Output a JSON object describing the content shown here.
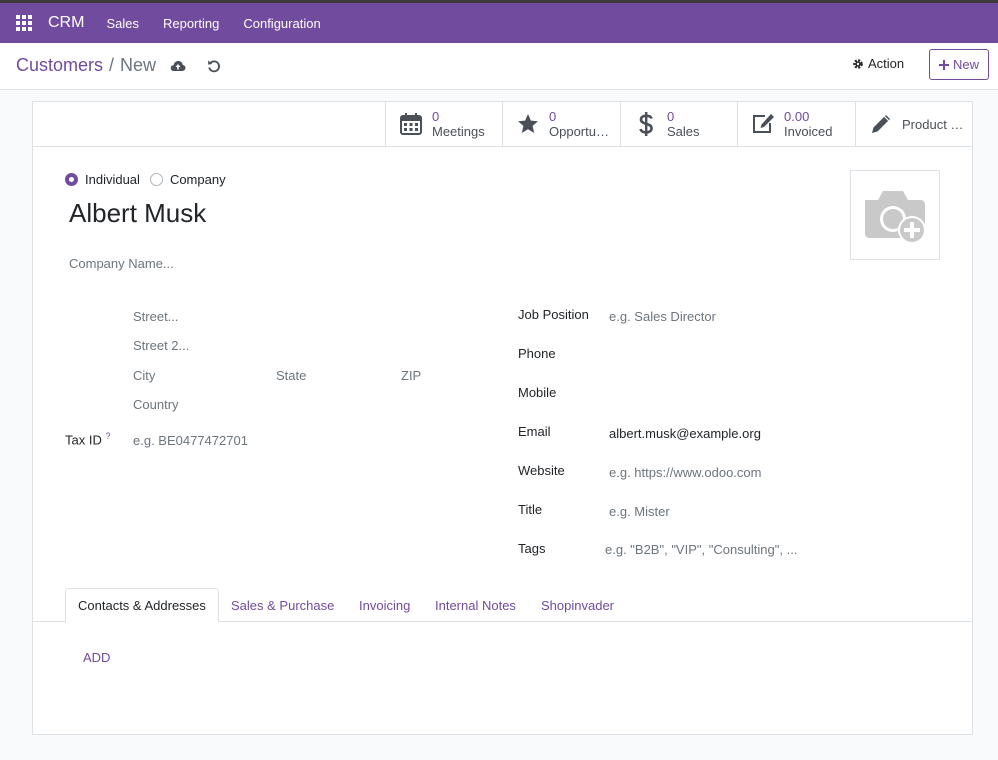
{
  "navbar": {
    "brand": "CRM",
    "menu": [
      "Sales",
      "Reporting",
      "Configuration"
    ]
  },
  "control": {
    "breadcrumb_parent": "Customers",
    "breadcrumb_sep": "/",
    "breadcrumb_current": "New",
    "action_label": "Action",
    "new_label": "New"
  },
  "smart_buttons": [
    {
      "value": "0",
      "label": "Meetings",
      "icon": "calendar-icon"
    },
    {
      "value": "0",
      "label": "Opportu…",
      "icon": "star-icon"
    },
    {
      "value": "0",
      "label": "Sales",
      "icon": "dollar-icon"
    },
    {
      "value": "0.00",
      "label": "Invoiced",
      "icon": "edit-icon"
    },
    {
      "value": "",
      "label": "Product …",
      "icon": "pencil-icon"
    }
  ],
  "form": {
    "type_options": [
      "Individual",
      "Company"
    ],
    "type_selected": "Individual",
    "name": "Albert Musk",
    "company_name_placeholder": "Company Name...",
    "address": {
      "street_placeholder": "Street...",
      "street2_placeholder": "Street 2...",
      "city_placeholder": "City",
      "state_placeholder": "State",
      "zip_placeholder": "ZIP",
      "country_placeholder": "Country"
    },
    "tax_id": {
      "label": "Tax ID",
      "help": "?",
      "placeholder": "e.g. BE0477472701"
    },
    "right_fields": {
      "job_position": {
        "label": "Job Position",
        "placeholder": "e.g. Sales Director"
      },
      "phone": {
        "label": "Phone",
        "value": ""
      },
      "mobile": {
        "label": "Mobile",
        "value": ""
      },
      "email": {
        "label": "Email",
        "value": "albert.musk@example.org"
      },
      "website": {
        "label": "Website",
        "placeholder": "e.g. https://www.odoo.com"
      },
      "title": {
        "label": "Title",
        "placeholder": "e.g. Mister"
      },
      "tags": {
        "label": "Tags",
        "placeholder": "e.g. \"B2B\", \"VIP\", \"Consulting\", ..."
      }
    }
  },
  "tabs": [
    "Contacts & Addresses",
    "Sales & Purchase",
    "Invoicing",
    "Internal Notes",
    "Shopinvader"
  ],
  "active_tab": "Contacts & Addresses",
  "add_label": "ADD",
  "colors": {
    "brand": "#714b9e",
    "muted": "#6c757d"
  }
}
